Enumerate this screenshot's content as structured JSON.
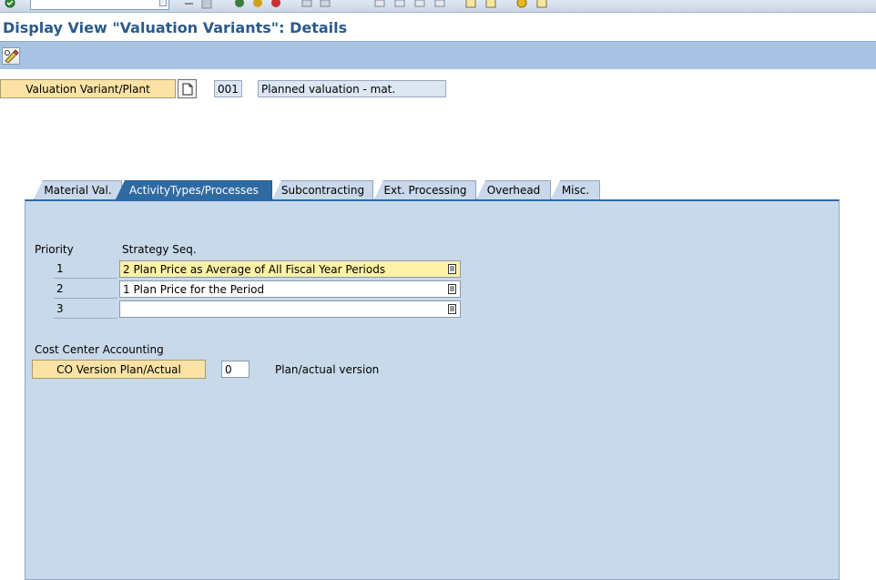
{
  "title": "Display View \"Valuation Variants\": Details",
  "header": {
    "key_label": "Valuation Variant/Plant",
    "key_value": "001",
    "key_desc": "Planned valuation - mat."
  },
  "tabs": [
    {
      "label": "Material Val."
    },
    {
      "label": "ActivityTypes/Processes"
    },
    {
      "label": "Subcontracting"
    },
    {
      "label": "Ext. Processing"
    },
    {
      "label": "Overhead"
    },
    {
      "label": "Misc."
    }
  ],
  "panel": {
    "priority_header": "Priority",
    "strategy_header": "Strategy Seq.",
    "rows": [
      {
        "priority": "1",
        "strategy": "2 Plan Price as Average of All Fiscal Year Periods"
      },
      {
        "priority": "2",
        "strategy": "1 Plan Price for the Period"
      },
      {
        "priority": "3",
        "strategy": ""
      }
    ],
    "cca_label": "Cost Center Accounting",
    "co_version_label": "CO Version Plan/Actual",
    "co_version_value": "0",
    "co_version_desc": "Plan/actual version"
  }
}
